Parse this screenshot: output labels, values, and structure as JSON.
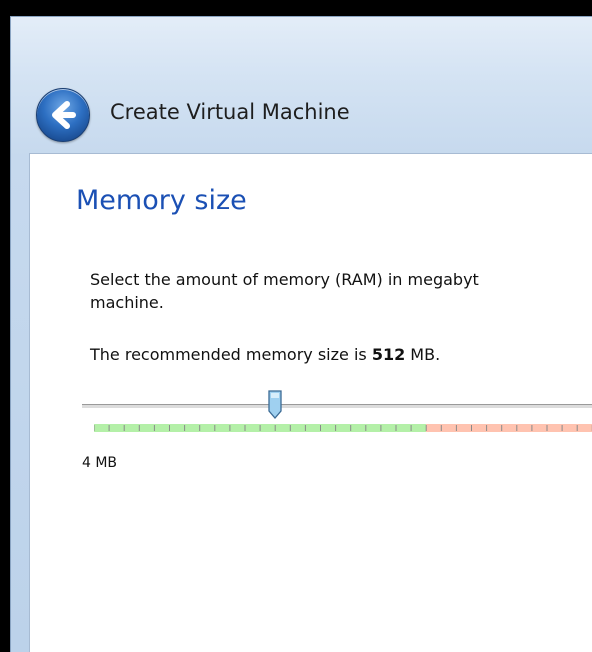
{
  "window": {
    "title": "Create Virtual Machine",
    "back_icon": "back-arrow-icon"
  },
  "page": {
    "heading": "Memory size",
    "description": "Select the amount of memory (RAM) in megabyt\nmachine.",
    "recommend_prefix": "The recommended memory size is ",
    "recommend_value": "512",
    "recommend_suffix": " MB."
  },
  "memory_slider": {
    "min_label": "4 MB",
    "thumb_tick_index": 12,
    "visible_ticks": 30,
    "green_zone_ticks": 22,
    "colors": {
      "safe_zone": "#b4f0a8",
      "warning_zone": "#ffc3b0",
      "thumb": "#9fd0f0"
    }
  },
  "colors": {
    "heading": "#1b50b4",
    "frame": "#c9dbee",
    "content_bg": "#ffffff"
  }
}
